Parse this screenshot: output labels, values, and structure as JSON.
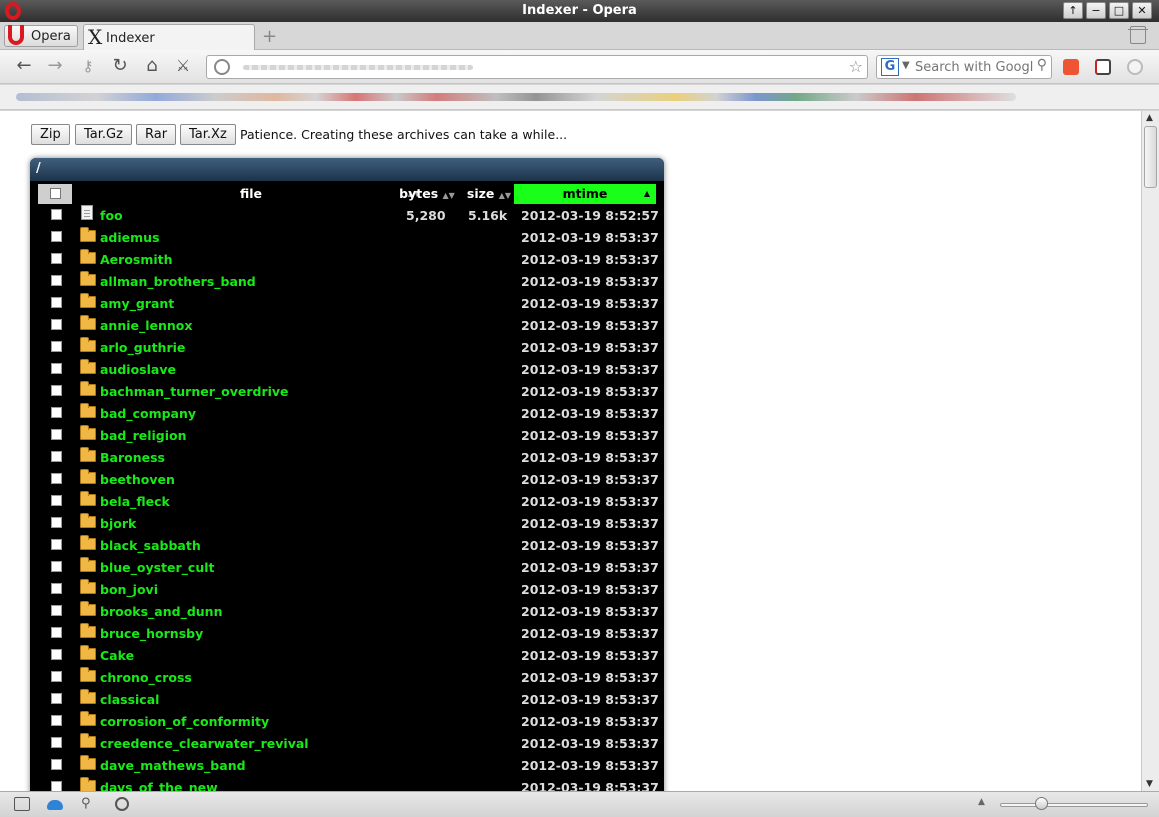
{
  "window": {
    "title": "Indexer - Opera",
    "buttons": [
      "↑",
      "−",
      "□",
      "✕"
    ]
  },
  "tabs": {
    "opera_menu_label": "Opera",
    "active_tab_label": "Indexer",
    "new_tab_symbol": "+"
  },
  "nav": {
    "search_placeholder": "Search with Googl",
    "search_engine_letter": "G"
  },
  "toolbar": {
    "buttons": [
      "Zip",
      "Tar.Gz",
      "Rar",
      "Tar.Xz"
    ],
    "message": "Patience. Creating these archives can take a while..."
  },
  "listing": {
    "path": "/",
    "columns": {
      "file": "file",
      "bytes": "bytes",
      "size": "size",
      "mtime": "mtime"
    },
    "sort_column": "mtime",
    "sort_color": "#19ff19",
    "rows": [
      {
        "type": "file",
        "name": "foo",
        "bytes": "5,280",
        "size": "5.16k",
        "mtime": "2012-03-19 8:52:57"
      },
      {
        "type": "folder",
        "name": "adiemus",
        "bytes": "",
        "size": "",
        "mtime": "2012-03-19 8:53:37"
      },
      {
        "type": "folder",
        "name": "Aerosmith",
        "bytes": "",
        "size": "",
        "mtime": "2012-03-19 8:53:37"
      },
      {
        "type": "folder",
        "name": "allman_brothers_band",
        "bytes": "",
        "size": "",
        "mtime": "2012-03-19 8:53:37"
      },
      {
        "type": "folder",
        "name": "amy_grant",
        "bytes": "",
        "size": "",
        "mtime": "2012-03-19 8:53:37"
      },
      {
        "type": "folder",
        "name": "annie_lennox",
        "bytes": "",
        "size": "",
        "mtime": "2012-03-19 8:53:37"
      },
      {
        "type": "folder",
        "name": "arlo_guthrie",
        "bytes": "",
        "size": "",
        "mtime": "2012-03-19 8:53:37"
      },
      {
        "type": "folder",
        "name": "audioslave",
        "bytes": "",
        "size": "",
        "mtime": "2012-03-19 8:53:37"
      },
      {
        "type": "folder",
        "name": "bachman_turner_overdrive",
        "bytes": "",
        "size": "",
        "mtime": "2012-03-19 8:53:37"
      },
      {
        "type": "folder",
        "name": "bad_company",
        "bytes": "",
        "size": "",
        "mtime": "2012-03-19 8:53:37"
      },
      {
        "type": "folder",
        "name": "bad_religion",
        "bytes": "",
        "size": "",
        "mtime": "2012-03-19 8:53:37"
      },
      {
        "type": "folder",
        "name": "Baroness",
        "bytes": "",
        "size": "",
        "mtime": "2012-03-19 8:53:37"
      },
      {
        "type": "folder",
        "name": "beethoven",
        "bytes": "",
        "size": "",
        "mtime": "2012-03-19 8:53:37"
      },
      {
        "type": "folder",
        "name": "bela_fleck",
        "bytes": "",
        "size": "",
        "mtime": "2012-03-19 8:53:37"
      },
      {
        "type": "folder",
        "name": "bjork",
        "bytes": "",
        "size": "",
        "mtime": "2012-03-19 8:53:37"
      },
      {
        "type": "folder",
        "name": "black_sabbath",
        "bytes": "",
        "size": "",
        "mtime": "2012-03-19 8:53:37"
      },
      {
        "type": "folder",
        "name": "blue_oyster_cult",
        "bytes": "",
        "size": "",
        "mtime": "2012-03-19 8:53:37"
      },
      {
        "type": "folder",
        "name": "bon_jovi",
        "bytes": "",
        "size": "",
        "mtime": "2012-03-19 8:53:37"
      },
      {
        "type": "folder",
        "name": "brooks_and_dunn",
        "bytes": "",
        "size": "",
        "mtime": "2012-03-19 8:53:37"
      },
      {
        "type": "folder",
        "name": "bruce_hornsby",
        "bytes": "",
        "size": "",
        "mtime": "2012-03-19 8:53:37"
      },
      {
        "type": "folder",
        "name": "Cake",
        "bytes": "",
        "size": "",
        "mtime": "2012-03-19 8:53:37"
      },
      {
        "type": "folder",
        "name": "chrono_cross",
        "bytes": "",
        "size": "",
        "mtime": "2012-03-19 8:53:37"
      },
      {
        "type": "folder",
        "name": "classical",
        "bytes": "",
        "size": "",
        "mtime": "2012-03-19 8:53:37"
      },
      {
        "type": "folder",
        "name": "corrosion_of_conformity",
        "bytes": "",
        "size": "",
        "mtime": "2012-03-19 8:53:37"
      },
      {
        "type": "folder",
        "name": "creedence_clearwater_revival",
        "bytes": "",
        "size": "",
        "mtime": "2012-03-19 8:53:37"
      },
      {
        "type": "folder",
        "name": "dave_mathews_band",
        "bytes": "",
        "size": "",
        "mtime": "2012-03-19 8:53:37"
      },
      {
        "type": "folder",
        "name": "days_of_the_new",
        "bytes": "",
        "size": "",
        "mtime": "2012-03-19 8:53:37"
      }
    ]
  },
  "icons": {
    "nav": [
      "back-icon",
      "forward-icon",
      "key-icon",
      "reload-icon",
      "home-icon",
      "wand-icon"
    ],
    "status": [
      "panel-toggle-icon",
      "cloud-icon",
      "share-icon",
      "turbo-icon"
    ]
  }
}
